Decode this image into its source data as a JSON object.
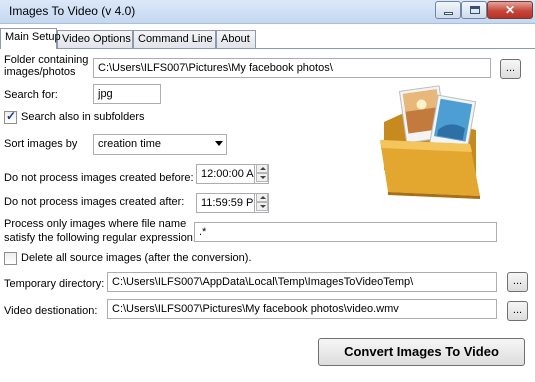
{
  "window": {
    "title": "Images To Video (v 4.0)"
  },
  "tabs": [
    "Main Setup",
    "Video Options",
    "Command Line",
    "About"
  ],
  "main": {
    "folder_label": "Folder containing images/photos",
    "folder_label_1": "Folder containing",
    "folder_label_2": "images/photos",
    "folder_value": "C:\\Users\\ILFS007\\Pictures\\My facebook photos\\",
    "browse_label": "...",
    "search_label": "Search for:",
    "search_value": "jpg",
    "subfolders_label": "Search also in subfolders",
    "subfolders_checked": true,
    "sort_label": "Sort images by",
    "sort_value": "creation time",
    "before_label": "Do not process images created before:",
    "before_value": "12:00:00 A",
    "after_label": "Do not process images created after:",
    "after_value": "11:59:59 P",
    "regex_label_1": "Process only images where file name",
    "regex_label_2": "satisfy the following regular expression:",
    "regex_value": ".*",
    "delete_label": "Delete all source images (after the conversion).",
    "delete_checked": false,
    "temp_label": "Temporary directory:",
    "temp_value": "C:\\Users\\ILFS007\\AppData\\Local\\Temp\\ImagesToVideoTemp\\",
    "dest_label": "Video destionation:",
    "dest_value": "C:\\Users\\ILFS007\\Pictures\\My facebook photos\\video.wmv",
    "convert_label": "Convert Images To Video"
  },
  "icons": {
    "window_buttons": [
      "minimize-icon",
      "maximize-icon",
      "close-icon"
    ],
    "illustration": "photo-folder-icon"
  },
  "colors": {
    "close_button": "#c7463a",
    "folder": "#e3a62f",
    "titlebar": "#c5d8f1"
  }
}
